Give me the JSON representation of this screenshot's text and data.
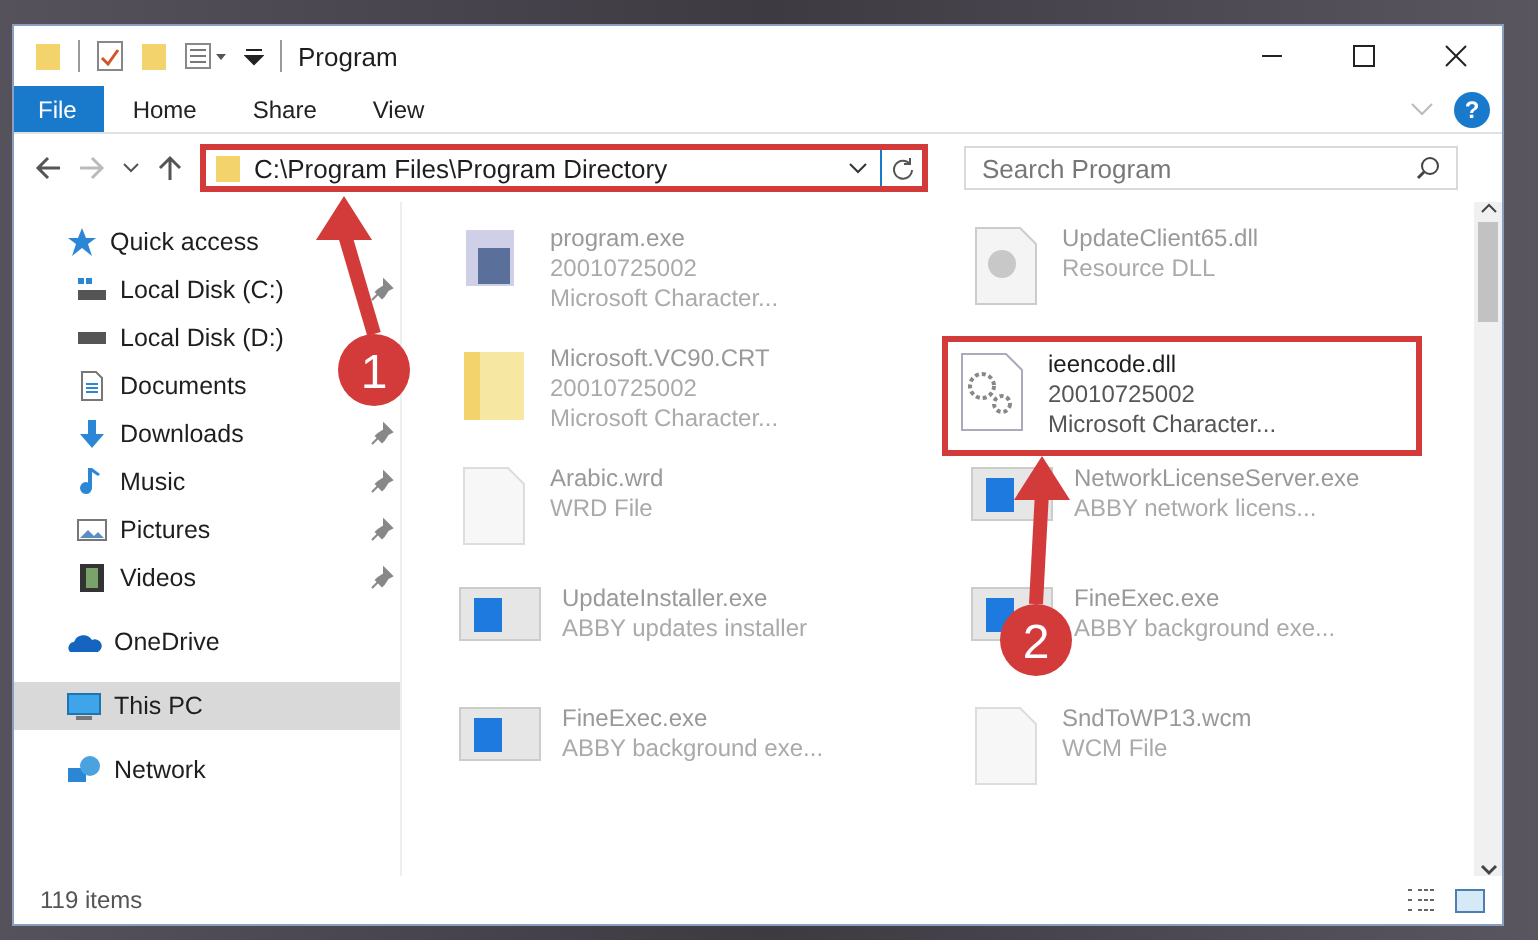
{
  "window": {
    "title": "Program"
  },
  "ribbon": {
    "tabs": [
      {
        "label": "File",
        "selected": true
      },
      {
        "label": "Home",
        "selected": false
      },
      {
        "label": "Share",
        "selected": false
      },
      {
        "label": "View",
        "selected": false
      }
    ],
    "help": "?"
  },
  "address_bar": {
    "path": "C:\\Program Files\\Program Directory",
    "highlighted": true
  },
  "search": {
    "placeholder": "Search Program"
  },
  "sidebar": {
    "items": [
      {
        "label": "Quick access",
        "kind": "quick",
        "selected": false,
        "children": [
          {
            "label": "Local Disk (C:)",
            "kind": "disk-c",
            "pinned": true,
            "selected": false
          },
          {
            "label": "Local Disk (D:)",
            "kind": "disk",
            "pinned": false,
            "selected": false
          },
          {
            "label": "Documents",
            "kind": "documents",
            "pinned": false,
            "selected": false
          },
          {
            "label": "Downloads",
            "kind": "downloads",
            "pinned": true,
            "selected": false
          },
          {
            "label": "Music",
            "kind": "music",
            "pinned": true,
            "selected": false
          },
          {
            "label": "Pictures",
            "kind": "pictures",
            "pinned": true,
            "selected": false
          },
          {
            "label": "Videos",
            "kind": "videos",
            "pinned": true,
            "selected": false
          }
        ]
      },
      {
        "label": "OneDrive",
        "kind": "cloud",
        "selected": false
      },
      {
        "label": "This PC",
        "kind": "pc",
        "selected": true
      },
      {
        "label": "Network",
        "kind": "network",
        "selected": false
      }
    ]
  },
  "files": [
    {
      "name": "program.exe",
      "details": [
        "20010725002",
        "Microsoft Character..."
      ],
      "kind": "exe",
      "highlighted": false
    },
    {
      "name": "UpdateClient65.dll",
      "details": [
        "Resource DLL"
      ],
      "kind": "resource",
      "highlighted": false
    },
    {
      "name": "Microsoft.VC90.CRT",
      "details": [
        "20010725002",
        "Microsoft Character..."
      ],
      "kind": "folder",
      "highlighted": false
    },
    {
      "name": "ieencode.dll",
      "details": [
        "20010725002",
        "Microsoft Character..."
      ],
      "kind": "dll",
      "highlighted": true
    },
    {
      "name": "Arabic.wrd",
      "details": [
        "WRD File"
      ],
      "kind": "blank",
      "highlighted": false
    },
    {
      "name": "NetworkLicenseServer.exe",
      "details": [
        "ABBY network licens..."
      ],
      "kind": "app",
      "highlighted": false
    },
    {
      "name": "UpdateInstaller.exe",
      "details": [
        "ABBY updates installer"
      ],
      "kind": "app",
      "highlighted": false
    },
    {
      "name": "FineExec.exe",
      "details": [
        "ABBY background exe..."
      ],
      "kind": "app",
      "highlighted": false
    },
    {
      "name": "FineExec.exe",
      "details": [
        "ABBY background exe..."
      ],
      "kind": "app",
      "highlighted": false
    },
    {
      "name": "SndToWP13.wcm",
      "details": [
        "WCM File"
      ],
      "kind": "blank",
      "highlighted": false
    }
  ],
  "status_bar": {
    "count": "119 items"
  },
  "annotations": [
    {
      "label": "1"
    },
    {
      "label": "2"
    }
  ]
}
